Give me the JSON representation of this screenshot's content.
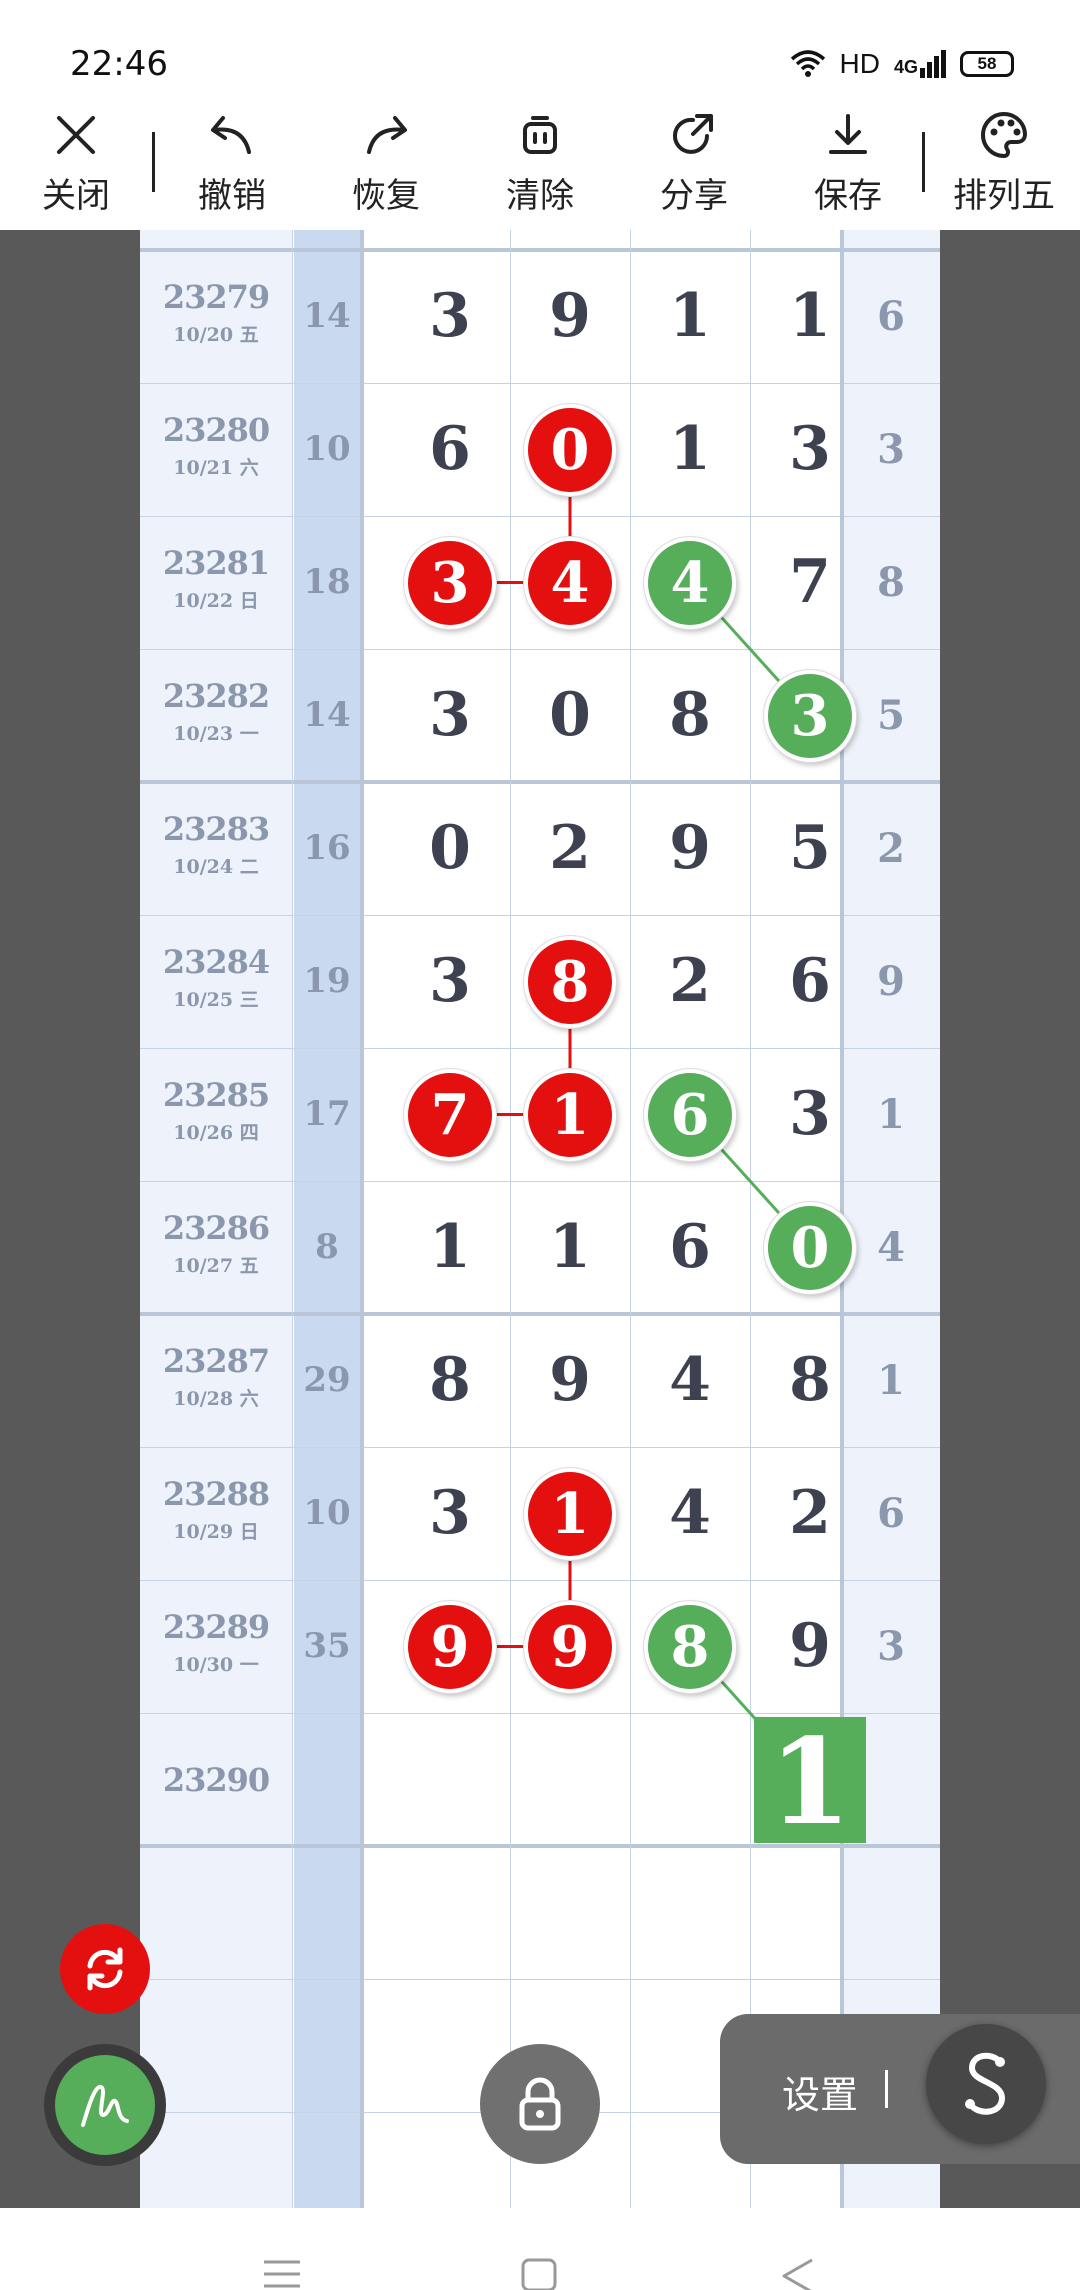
{
  "status_bar": {
    "time": "22:46",
    "network": "HD",
    "network_gen": "4G",
    "battery": "58"
  },
  "toolbar": {
    "close_label": "关闭",
    "undo_label": "撤销",
    "redo_label": "恢复",
    "clear_label": "清除",
    "share_label": "分享",
    "save_label": "保存",
    "theme_label": "排列五"
  },
  "grid": {
    "rows": [
      {
        "issue": "23279",
        "date": "10/20 五",
        "sum": "14",
        "digits": [
          "3",
          "9",
          "1",
          "1"
        ],
        "tail": "6"
      },
      {
        "issue": "23280",
        "date": "10/21 六",
        "sum": "10",
        "digits": [
          "6",
          "0",
          "1",
          "3"
        ],
        "tail": "3"
      },
      {
        "issue": "23281",
        "date": "10/22 日",
        "sum": "18",
        "digits": [
          "3",
          "4",
          "4",
          "7"
        ],
        "tail": "8"
      },
      {
        "issue": "23282",
        "date": "10/23 一",
        "sum": "14",
        "digits": [
          "3",
          "0",
          "8",
          "3"
        ],
        "tail": "5"
      },
      {
        "issue": "23283",
        "date": "10/24 二",
        "sum": "16",
        "digits": [
          "0",
          "2",
          "9",
          "5"
        ],
        "tail": "2"
      },
      {
        "issue": "23284",
        "date": "10/25 三",
        "sum": "19",
        "digits": [
          "3",
          "8",
          "2",
          "6"
        ],
        "tail": "9"
      },
      {
        "issue": "23285",
        "date": "10/26 四",
        "sum": "17",
        "digits": [
          "7",
          "1",
          "6",
          "3"
        ],
        "tail": "1"
      },
      {
        "issue": "23286",
        "date": "10/27 五",
        "sum": "8",
        "digits": [
          "1",
          "1",
          "6",
          "0"
        ],
        "tail": "4"
      },
      {
        "issue": "23287",
        "date": "10/28 六",
        "sum": "29",
        "digits": [
          "8",
          "9",
          "4",
          "8"
        ],
        "tail": "1"
      },
      {
        "issue": "23288",
        "date": "10/29 日",
        "sum": "10",
        "digits": [
          "3",
          "1",
          "4",
          "2"
        ],
        "tail": "6"
      },
      {
        "issue": "23289",
        "date": "10/30 一",
        "sum": "35",
        "digits": [
          "9",
          "9",
          "8",
          "9"
        ],
        "tail": "3"
      },
      {
        "issue": "23290",
        "date": "",
        "sum": "",
        "digits": [
          "",
          "",
          "",
          ""
        ],
        "tail": ""
      }
    ],
    "marks": [
      {
        "row": 1,
        "col": 1,
        "color": "red"
      },
      {
        "row": 2,
        "col": 0,
        "color": "red"
      },
      {
        "row": 2,
        "col": 1,
        "color": "red"
      },
      {
        "row": 2,
        "col": 2,
        "color": "green"
      },
      {
        "row": 3,
        "col": 3,
        "color": "green"
      },
      {
        "row": 5,
        "col": 1,
        "color": "red"
      },
      {
        "row": 6,
        "col": 0,
        "color": "red"
      },
      {
        "row": 6,
        "col": 1,
        "color": "red"
      },
      {
        "row": 6,
        "col": 2,
        "color": "green"
      },
      {
        "row": 7,
        "col": 3,
        "color": "green"
      },
      {
        "row": 9,
        "col": 1,
        "color": "red"
      },
      {
        "row": 10,
        "col": 0,
        "color": "red"
      },
      {
        "row": 10,
        "col": 1,
        "color": "red"
      },
      {
        "row": 10,
        "col": 2,
        "color": "green"
      }
    ],
    "prediction": {
      "row": 11,
      "col": 3,
      "value": "1",
      "color": "green"
    },
    "colors": {
      "red": "#e40f0f",
      "green": "#56ad5a"
    }
  },
  "floating": {
    "refresh_icon": "refresh-icon",
    "draw_icon": "pen-icon",
    "lock_icon": "lock-icon",
    "settings_label": "设置",
    "s_icon": "s-curve-icon"
  }
}
